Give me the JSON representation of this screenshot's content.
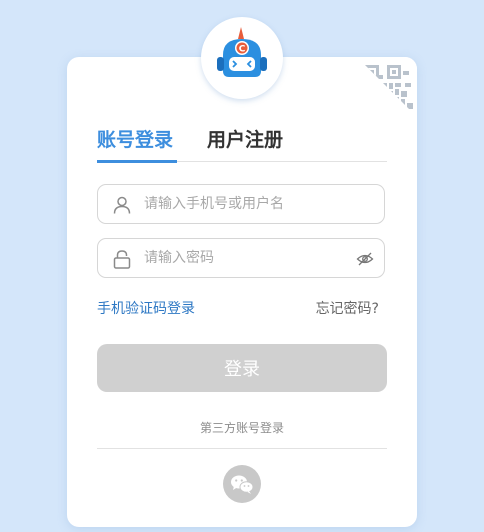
{
  "brand": {
    "logo_icon": "robot-mascot-icon",
    "logo_badge_letter": "C",
    "accent_color": "#3d8ede"
  },
  "tabs": [
    {
      "label": "账号登录",
      "active": true
    },
    {
      "label": "用户注册",
      "active": false
    }
  ],
  "form": {
    "username": {
      "placeholder": "请输入手机号或用户名",
      "value": "",
      "icon": "user-icon"
    },
    "password": {
      "placeholder": "请输入密码",
      "value": "",
      "icon": "lock-icon",
      "toggle_icon": "eye-hidden-icon"
    }
  },
  "links": {
    "sms_login": "手机验证码登录",
    "forgot_password": "忘记密码?"
  },
  "login_button": {
    "label": "登录",
    "disabled_color": "#d0d0d0"
  },
  "third_party": {
    "label": "第三方账号登录",
    "providers": [
      {
        "name": "wechat",
        "icon": "wechat-icon"
      }
    ]
  },
  "qr_toggle": {
    "icon": "qr-code-icon"
  }
}
